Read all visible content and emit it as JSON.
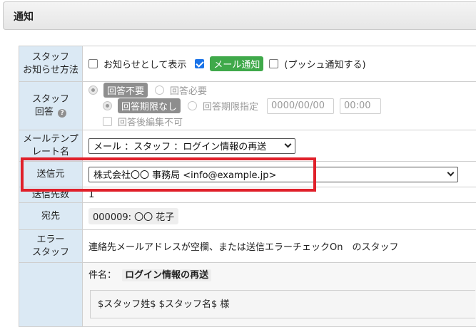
{
  "panel": {
    "title": "通知"
  },
  "rows": {
    "staff_notice_method": {
      "label_line1": "スタッフ",
      "label_line2": "お知らせ方法",
      "show_as_notice_label": "お知らせとして表示",
      "show_as_notice_checked": false,
      "mail_notice_label": "メール通知",
      "mail_notice_checked": true,
      "push_notice_label": "(プッシュ通知する)",
      "push_notice_checked": false
    },
    "staff_answer": {
      "label_line1": "スタッフ",
      "label_line2": "回答",
      "help_icon": "?",
      "no_answer_label": "回答不要",
      "answer_required_label": "回答必要",
      "no_deadline_label": "回答期限なし",
      "deadline_label": "回答期限指定",
      "date_placeholder": "0000/00/00",
      "time_placeholder": "00:00",
      "no_edit_after_label": "回答後編集不可"
    },
    "mail_template": {
      "label_line1": "メールテンプ",
      "label_line2": "レート名",
      "selected": "メール ：スタッフ ：ログイン情報の再送"
    },
    "sender": {
      "label": "送信元",
      "selected": "株式会社〇〇 事務局 <info@example.jp>"
    },
    "send_count": {
      "label": "送信先数",
      "value": "1"
    },
    "recipient": {
      "label": "宛先",
      "chip": "000009: 〇〇 花子"
    },
    "error_staff": {
      "label_line1": "エラー",
      "label_line2": "スタッフ",
      "text": "連絡先メールアドレスが空欄、または送信エラーチェックOn　のスタッフ"
    },
    "mail_body": {
      "subject_label": "件名：",
      "subject_value": "ログイン情報の再送",
      "body_text": "$スタッフ姓$ $スタッフ名$ 様"
    }
  },
  "colors": {
    "label_bg": "#dbe9f4",
    "mail_tag": "#3fa94a",
    "highlight": "#e0202a"
  }
}
